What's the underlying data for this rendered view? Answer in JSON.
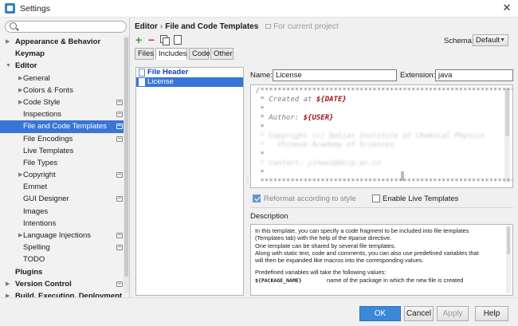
{
  "window": {
    "title": "Settings",
    "close": "✕"
  },
  "sidebar": {
    "search": {
      "placeholder": "",
      "value": ""
    },
    "items": [
      {
        "label": "Appearance & Behavior",
        "arrow": "▶",
        "bold": true,
        "indent": 0
      },
      {
        "label": "Keymap",
        "arrow": "",
        "bold": true,
        "indent": 0
      },
      {
        "label": "Editor",
        "arrow": "▼",
        "bold": true,
        "indent": 0
      },
      {
        "label": "General",
        "arrow": "▶",
        "indent": 1
      },
      {
        "label": "Colors & Fonts",
        "arrow": "▶",
        "indent": 1
      },
      {
        "label": "Code Style",
        "arrow": "▶",
        "indent": 1,
        "project": true
      },
      {
        "label": "Inspections",
        "arrow": "",
        "indent": 1,
        "project": true
      },
      {
        "label": "File and Code Templates",
        "arrow": "",
        "indent": 1,
        "project": true,
        "selected": true
      },
      {
        "label": "File Encodings",
        "arrow": "",
        "indent": 1,
        "project": true
      },
      {
        "label": "Live Templates",
        "arrow": "",
        "indent": 1
      },
      {
        "label": "File Types",
        "arrow": "",
        "indent": 1
      },
      {
        "label": "Copyright",
        "arrow": "▶",
        "indent": 1,
        "project": true
      },
      {
        "label": "Emmet",
        "arrow": "",
        "indent": 1
      },
      {
        "label": "GUI Designer",
        "arrow": "",
        "indent": 1,
        "project": true
      },
      {
        "label": "Images",
        "arrow": "",
        "indent": 1
      },
      {
        "label": "Intentions",
        "arrow": "",
        "indent": 1
      },
      {
        "label": "Language Injections",
        "arrow": "▶",
        "indent": 1,
        "project": true
      },
      {
        "label": "Spelling",
        "arrow": "",
        "indent": 1,
        "project": true
      },
      {
        "label": "TODO",
        "arrow": "",
        "indent": 1
      },
      {
        "label": "Plugins",
        "arrow": "",
        "bold": true,
        "indent": 0
      },
      {
        "label": "Version Control",
        "arrow": "▶",
        "bold": true,
        "indent": 0,
        "project": true
      },
      {
        "label": "Build, Execution, Deployment",
        "arrow": "▶",
        "bold": true,
        "indent": 0
      }
    ]
  },
  "main": {
    "breadcrumb": {
      "part1": "Editor",
      "sep": "›",
      "part2": "File and Code Templates",
      "note": "For current project"
    },
    "toolbar": {
      "add": "+",
      "remove": "−"
    },
    "schema": {
      "label": "Schema:",
      "value": "Default",
      "chevron": "▼"
    },
    "tabs": [
      "Files",
      "Includes",
      "Code",
      "Other"
    ],
    "active_tab": "Includes",
    "templates": [
      {
        "label": "File Header",
        "kind": "header"
      },
      {
        "label": "License",
        "kind": "selected"
      }
    ],
    "name": {
      "label": "Name:",
      "value": "License"
    },
    "extension": {
      "label": "Extension:",
      "value": "java"
    },
    "editor_lines": [
      {
        "text": "/***********************************************************",
        "blur": false
      },
      {
        "text": " * Created at ",
        "var": "${DATE}",
        "blur": false
      },
      {
        "text": " *",
        "blur": false
      },
      {
        "text": " * Author: ",
        "var": "${USER}",
        "blur": false
      },
      {
        "text": " *",
        "blur": false
      },
      {
        "text": " * Copyright (c) Dalian Institute of Chemical Physics",
        "blur": true
      },
      {
        "text": " *   Chinese Academy of Sciences",
        "blur": true
      },
      {
        "text": " *",
        "blur": false
      },
      {
        "text": " * Contact: jinwei@dicp.ac.cn",
        "blur": true
      },
      {
        "text": " *",
        "blur": false
      },
      {
        "text": " ***********************************************************/",
        "blur": false
      }
    ],
    "splitter": "⋮",
    "reformat": {
      "label": "Reformat according to style",
      "checked": true
    },
    "live_templates": {
      "label": "Enable Live Templates",
      "checked": false
    },
    "description": {
      "title": "Description",
      "lines": [
        "In this template, you can specify a code fragment to be included into file templates",
        "(Templates tab) with the help of the #parse directive.",
        "One template can be shared by several file templates.",
        "Along with static text, code and comments, you can also use predefined variables that",
        "will then be expanded like macros into the corresponding values."
      ],
      "predefined": "Predefined variables will take the following values:",
      "var_name": "${PACKAGE_NAME}",
      "var_desc": "name of the package in which the new file is created"
    }
  },
  "buttons": {
    "ok": "OK",
    "cancel": "Cancel",
    "apply": "Apply",
    "help": "Help"
  }
}
